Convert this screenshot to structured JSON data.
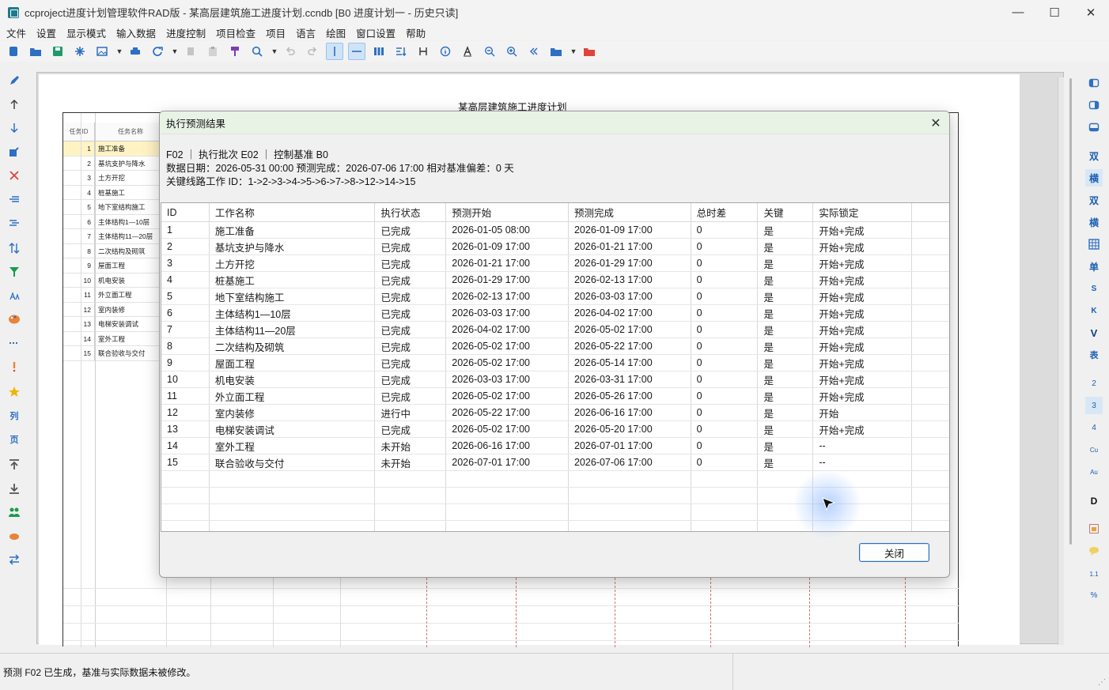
{
  "window": {
    "title": "ccproject进度计划管理软件RAD版 - 某高层建筑施工进度计划.ccndb [B0 进度计划一 - 历史只读]",
    "min": "—",
    "max": "☐",
    "close": "✕"
  },
  "menu": [
    "文件",
    "设置",
    "显示模式",
    "输入数据",
    "进度控制",
    "项目检查",
    "项目",
    "语言",
    "绘图",
    "窗口设置",
    "帮助"
  ],
  "canvas": {
    "title": "某高层建筑施工进度计划",
    "header_id": "任务ID",
    "header_name": "任务名称",
    "rows": [
      {
        "id": "1",
        "name": "施工准备"
      },
      {
        "id": "2",
        "name": "基坑支护与降水"
      },
      {
        "id": "3",
        "name": "土方开挖"
      },
      {
        "id": "4",
        "name": "桩基施工"
      },
      {
        "id": "5",
        "name": "地下室结构施工"
      },
      {
        "id": "6",
        "name": "主体结构1—10层"
      },
      {
        "id": "7",
        "name": "主体结构11—20层"
      },
      {
        "id": "8",
        "name": "二次结构及砌筑"
      },
      {
        "id": "9",
        "name": "屋面工程"
      },
      {
        "id": "10",
        "name": "机电安装"
      },
      {
        "id": "11",
        "name": "外立面工程"
      },
      {
        "id": "12",
        "name": "室内装修"
      },
      {
        "id": "13",
        "name": "电梯安装调试"
      },
      {
        "id": "14",
        "name": "室外工程"
      },
      {
        "id": "15",
        "name": "联合验收与交付"
      }
    ]
  },
  "right_tools": [
    "双",
    "横",
    "双",
    "横",
    "单",
    "S",
    "K",
    "V",
    "表",
    "2",
    "3",
    "4",
    "Cu",
    "Au",
    "D",
    "1.1",
    "%"
  ],
  "dialog": {
    "title": "执行预测结果",
    "close_glyph": "✕",
    "info_line1": "F02 ｜ 执行批次 E02 ｜ 控制基准 B0",
    "info_line2": "数据日期：2026-05-31 00:00    预测完成：2026-07-06 17:00    相对基准偏差：0 天",
    "info_line3": "关键线路工作 ID：1->2->3->4->5->6->7->8->12->14->15",
    "columns": [
      "ID",
      "工作名称",
      "执行状态",
      "预测开始",
      "预测完成",
      "总时差",
      "关键",
      "实际锁定",
      ""
    ],
    "rows": [
      [
        "1",
        "施工准备",
        "已完成",
        "2026-01-05 08:00",
        "2026-01-09 17:00",
        "0",
        "是",
        "开始+完成"
      ],
      [
        "2",
        "基坑支护与降水",
        "已完成",
        "2026-01-09 17:00",
        "2026-01-21 17:00",
        "0",
        "是",
        "开始+完成"
      ],
      [
        "3",
        "土方开挖",
        "已完成",
        "2026-01-21 17:00",
        "2026-01-29 17:00",
        "0",
        "是",
        "开始+完成"
      ],
      [
        "4",
        "桩基施工",
        "已完成",
        "2026-01-29 17:00",
        "2026-02-13 17:00",
        "0",
        "是",
        "开始+完成"
      ],
      [
        "5",
        "地下室结构施工",
        "已完成",
        "2026-02-13 17:00",
        "2026-03-03 17:00",
        "0",
        "是",
        "开始+完成"
      ],
      [
        "6",
        "主体结构1—10层",
        "已完成",
        "2026-03-03 17:00",
        "2026-04-02 17:00",
        "0",
        "是",
        "开始+完成"
      ],
      [
        "7",
        "主体结构11—20层",
        "已完成",
        "2026-04-02 17:00",
        "2026-05-02 17:00",
        "0",
        "是",
        "开始+完成"
      ],
      [
        "8",
        "二次结构及砌筑",
        "已完成",
        "2026-05-02 17:00",
        "2026-05-22 17:00",
        "0",
        "是",
        "开始+完成"
      ],
      [
        "9",
        "屋面工程",
        "已完成",
        "2026-05-02 17:00",
        "2026-05-14 17:00",
        "0",
        "是",
        "开始+完成"
      ],
      [
        "10",
        "机电安装",
        "已完成",
        "2026-03-03 17:00",
        "2026-03-31 17:00",
        "0",
        "是",
        "开始+完成"
      ],
      [
        "11",
        "外立面工程",
        "已完成",
        "2026-05-02 17:00",
        "2026-05-26 17:00",
        "0",
        "是",
        "开始+完成"
      ],
      [
        "12",
        "室内装修",
        "进行中",
        "2026-05-22 17:00",
        "2026-06-16 17:00",
        "0",
        "是",
        "开始"
      ],
      [
        "13",
        "电梯安装调试",
        "已完成",
        "2026-05-02 17:00",
        "2026-05-20 17:00",
        "0",
        "是",
        "开始+完成"
      ],
      [
        "14",
        "室外工程",
        "未开始",
        "2026-06-16 17:00",
        "2026-07-01 17:00",
        "0",
        "是",
        "--"
      ],
      [
        "15",
        "联合验收与交付",
        "未开始",
        "2026-07-01 17:00",
        "2026-07-06 17:00",
        "0",
        "是",
        "--"
      ]
    ],
    "close_button": "关闭"
  },
  "status": {
    "message": "预测 F02 已生成，基准与实际数据未被修改。"
  }
}
